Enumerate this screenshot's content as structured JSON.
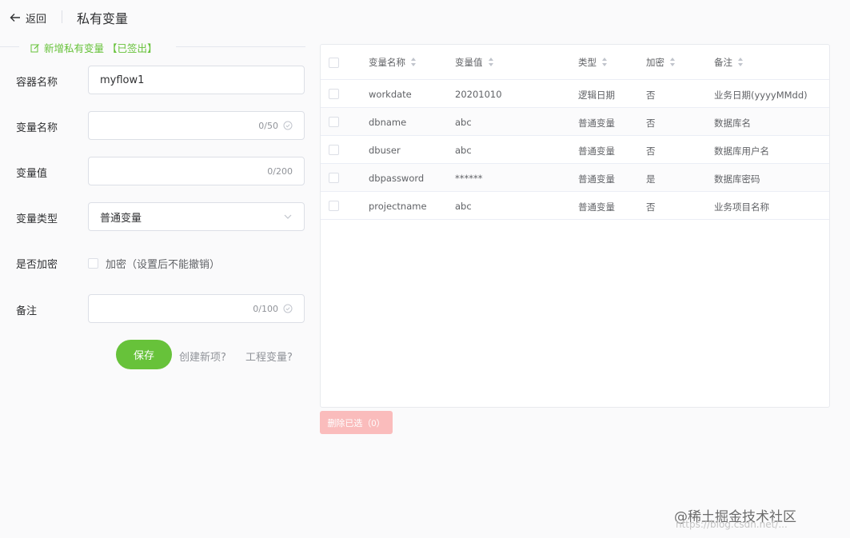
{
  "header": {
    "back_label": "返回",
    "title": "私有变量"
  },
  "section": {
    "title": "新增私有变量 【已签出】",
    "accent_color": "#67c23a",
    "icon": "edit-icon"
  },
  "form": {
    "container": {
      "label": "容器名称",
      "value": "myflow1"
    },
    "var_name": {
      "label": "变量名称",
      "value": "",
      "count": "0/50"
    },
    "var_value": {
      "label": "变量值",
      "value": "",
      "count": "0/200"
    },
    "var_type": {
      "label": "变量类型",
      "selected": "普通变量"
    },
    "encrypt": {
      "label": "是否加密",
      "checkbox_label": "加密（设置后不能撤销）",
      "checked": false
    },
    "remark": {
      "label": "备注",
      "value": "",
      "count": "0/100"
    },
    "save_label": "保存",
    "link_new": "创建新项?",
    "link_project": "工程变量?"
  },
  "table": {
    "columns": [
      "变量名称",
      "变量值",
      "类型",
      "加密",
      "备注"
    ],
    "rows": [
      {
        "name": "workdate",
        "value": "20201010",
        "type": "逻辑日期",
        "encrypted": "否",
        "remark": "业务日期(yyyyMMdd)"
      },
      {
        "name": "dbname",
        "value": "abc",
        "type": "普通变量",
        "encrypted": "否",
        "remark": "数据库名"
      },
      {
        "name": "dbuser",
        "value": "abc",
        "type": "普通变量",
        "encrypted": "否",
        "remark": "数据库用户名"
      },
      {
        "name": "dbpassword",
        "value": "******",
        "type": "普通变量",
        "encrypted": "是",
        "remark": "数据库密码"
      },
      {
        "name": "projectname",
        "value": "abc",
        "type": "普通变量",
        "encrypted": "否",
        "remark": "业务项目名称"
      }
    ]
  },
  "delete_label": "删除已选（0）",
  "watermark": {
    "line1": "@稀土掘金技术社区",
    "line2": "https://blog.csdn.net/..."
  }
}
